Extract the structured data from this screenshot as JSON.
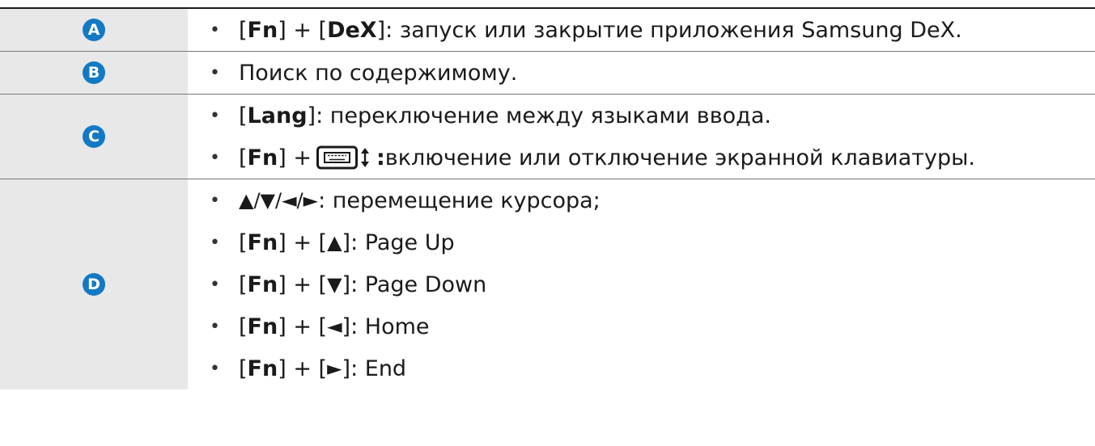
{
  "rows": [
    {
      "key": "A",
      "lines": [
        {
          "parts": [
            "[",
            "Fn",
            "] + [",
            "DeX",
            "]: запуск или закрытие приложения Samsung DeX."
          ]
        }
      ]
    },
    {
      "key": "B",
      "lines": [
        {
          "text": "Поиск по содержимому."
        }
      ]
    },
    {
      "key": "C",
      "lines": [
        {
          "parts": [
            "[",
            "Lang",
            "]: переключение между языками ввода."
          ]
        },
        {
          "pre": "[",
          "bold": "Fn",
          "mid": "] + ",
          "icon": "keyboard-toggle-icon",
          "colon": ":",
          "post": " включение или отключение экранной клавиатуры."
        }
      ]
    },
    {
      "key": "D",
      "lines": [
        {
          "arrows": "▲/▼/◄/►",
          "text": ": перемещение курсора;"
        },
        {
          "pre": "[",
          "bold": "Fn",
          "mid": "] + [",
          "arrow": "▲",
          "post": "]: Page Up"
        },
        {
          "pre": "[",
          "bold": "Fn",
          "mid": "] + [",
          "arrow": "▼",
          "post": "]: Page Down"
        },
        {
          "pre": "[",
          "bold": "Fn",
          "mid": "] + [",
          "arrow": "◄",
          "post": "]: Home"
        },
        {
          "pre": "[",
          "bold": "Fn",
          "mid": "] + [",
          "arrow": "►",
          "post": "]: End"
        }
      ]
    }
  ],
  "bullet": "•",
  "colors": {
    "badge": "#1479c3",
    "key_cell_bg": "#e8e8e8"
  }
}
